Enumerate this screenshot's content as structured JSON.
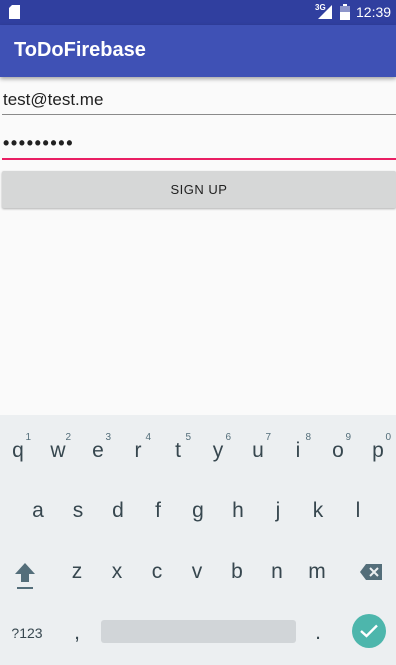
{
  "status_bar": {
    "network_label": "3G",
    "time": "12:39",
    "icons": [
      "sd-card-icon",
      "signal-icon",
      "battery-icon"
    ]
  },
  "app_bar": {
    "title": "ToDoFirebase"
  },
  "form": {
    "email_value": "test@test.me",
    "password_mask": "•••••••••",
    "signup_label": "SIGN UP"
  },
  "keyboard": {
    "row1": [
      {
        "label": "q",
        "hint": "1"
      },
      {
        "label": "w",
        "hint": "2"
      },
      {
        "label": "e",
        "hint": "3"
      },
      {
        "label": "r",
        "hint": "4"
      },
      {
        "label": "t",
        "hint": "5"
      },
      {
        "label": "y",
        "hint": "6"
      },
      {
        "label": "u",
        "hint": "7"
      },
      {
        "label": "i",
        "hint": "8"
      },
      {
        "label": "o",
        "hint": "9"
      },
      {
        "label": "p",
        "hint": "0"
      }
    ],
    "row2": [
      "a",
      "s",
      "d",
      "f",
      "g",
      "h",
      "j",
      "k",
      "l"
    ],
    "row3": [
      "z",
      "x",
      "c",
      "v",
      "b",
      "n",
      "m"
    ],
    "symbols_label": "?123",
    "comma_label": ",",
    "period_label": ".",
    "shift_icon": "shift-icon",
    "delete_icon": "backspace-icon",
    "enter_icon": "checkmark-icon"
  },
  "colors": {
    "status_bar": "#303f9f",
    "app_bar": "#3f51b5",
    "accent": "#e91e63",
    "enter_key": "#4db6ac"
  }
}
